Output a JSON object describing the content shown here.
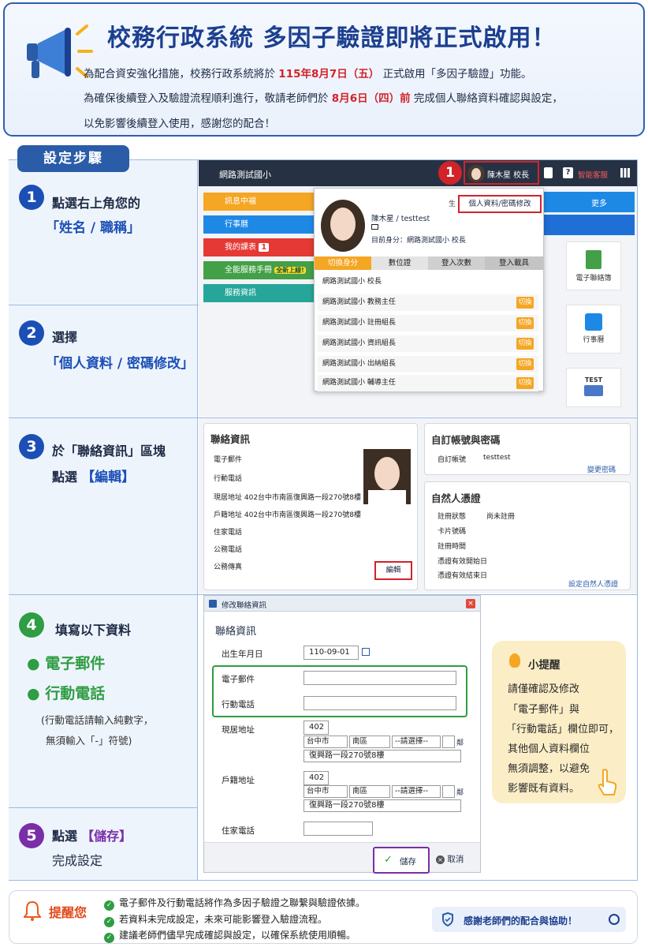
{
  "header": {
    "title": "校務行政系統 多因子驗證即將正式啟用！",
    "line1": {
      "a": "為配合資安強化措施，校務行政系統將於",
      "b": "115年8月7日（五）",
      "c": "正式啟用「多因子驗證」功能。"
    },
    "line2": {
      "a": "為確保後續登入及驗證流程順利進行，敬請老師們於",
      "b": "8月6日（四）前",
      "c": "完成個人聯絡資料確認與設定，"
    },
    "line3": "以免影響後續登入使用，感謝您的配合！"
  },
  "steps_title": "設定步驟",
  "steps": [
    {
      "num": "1",
      "line1": "點選右上角您的",
      "highlight": "「姓名 / 職稱」"
    },
    {
      "num": "2",
      "line1": "選擇",
      "highlight": "「個人資料 / 密碼修改」"
    },
    {
      "num": "3",
      "line1": "於「聯絡資訊」區塊",
      "line2a": "點選",
      "highlight": "【編輯】"
    },
    {
      "num": "4",
      "line1": "填寫以下資料",
      "bullets": [
        "電子郵件",
        "行動電話"
      ],
      "note1": "(行動電話請輸入純數字，",
      "note2": "無須輸入「-」符號)"
    },
    {
      "num": "5",
      "line1a": "點選",
      "highlight": "【儲存】",
      "line2": "完成設定"
    }
  ],
  "shot1": {
    "school": "網路測試國小",
    "callout_num": "1",
    "user_label": "陳木星 校長",
    "smart_service": "智能客服",
    "menu": [
      "訊息中福",
      "行事曆",
      "我的課表",
      "全能服務手冊",
      "服務資訊"
    ],
    "menu_badge": "1",
    "menu_new_badge": "全新上線!",
    "more": "更多",
    "profile_link": "個人資料/密碼修改",
    "popup_user": "陳木星 / testtest",
    "popup_identity": "目前身分：網路測試國小 校長",
    "tabs": [
      "切換身分",
      "數位證",
      "登入次數",
      "登入載具"
    ],
    "current_row": "網路測試國小 校長",
    "rows": [
      "網路測試國小 教務主任",
      "網路測試國小 註冊組長",
      "網路測試國小 資訊組長",
      "網路測試國小 出納組長",
      "網路測試國小 輔導主任"
    ],
    "switch_label": "切換",
    "icons": [
      "電子聯絡簿",
      "行事曆",
      "TEST"
    ]
  },
  "shot2": {
    "contact_title": "聯絡資訊",
    "contact_fields": [
      "電子郵件",
      "行動電話",
      "現居地址 402台中市南區復興路一段270號8樓",
      "戶籍地址 402台中市南區復興路一段270號8樓",
      "住家電話",
      "公務電話",
      "公務傳真"
    ],
    "edit_btn": "編輯",
    "account_title": "自訂帳號與密碼",
    "account_label": "自訂帳號",
    "account_value": "testtest",
    "change_pw": "變更密碼",
    "cert_title": "自然人憑證",
    "cert_fields": [
      {
        "label": "註冊狀態",
        "value": "尚未註冊"
      },
      {
        "label": "卡片號碼",
        "value": ""
      },
      {
        "label": "註冊時間",
        "value": ""
      },
      {
        "label": "憑證有效開始日",
        "value": ""
      },
      {
        "label": "憑證有效結束日",
        "value": ""
      }
    ],
    "set_cert": "設定自然人憑證"
  },
  "form": {
    "title": "修改聯絡資訊",
    "section": "聯絡資訊",
    "birthday_label": "出生年月日",
    "birthday_value": "110-09-01",
    "email_label": "電子郵件",
    "mobile_label": "行動電話",
    "addr1_label": "現居地址",
    "addr2_label": "戶籍地址",
    "zip": "402",
    "city": "台中市",
    "district": "南區",
    "select_placeholder": "--請選擇--",
    "lin_suffix": "鄰",
    "street": "復興路一段270號8樓",
    "home_phone_label": "住家電話",
    "save": "儲存",
    "cancel": "取消"
  },
  "tip": {
    "title": "小提醒",
    "lines": [
      "請僅確認及修改",
      "「電子郵件」與",
      "「行動電話」欄位即可，",
      "其他個人資料欄位",
      "無須調整，以避免",
      "影響既有資料。"
    ]
  },
  "bottom": {
    "label": "提醒您",
    "items": [
      "電子郵件及行動電話將作為多因子驗證之聯繫與驗證依據。",
      "若資料未完成設定，未來可能影響登入驗證流程。",
      "建議老師們儘早完成確認與設定，以確保系統使用順暢。"
    ],
    "thanks": "感謝老師們的配合與協助！"
  },
  "colors": {
    "brand_blue": "#2a5ca8",
    "alert_red": "#d2232a",
    "success_green": "#2e9d43",
    "purple": "#7a2ea8"
  }
}
